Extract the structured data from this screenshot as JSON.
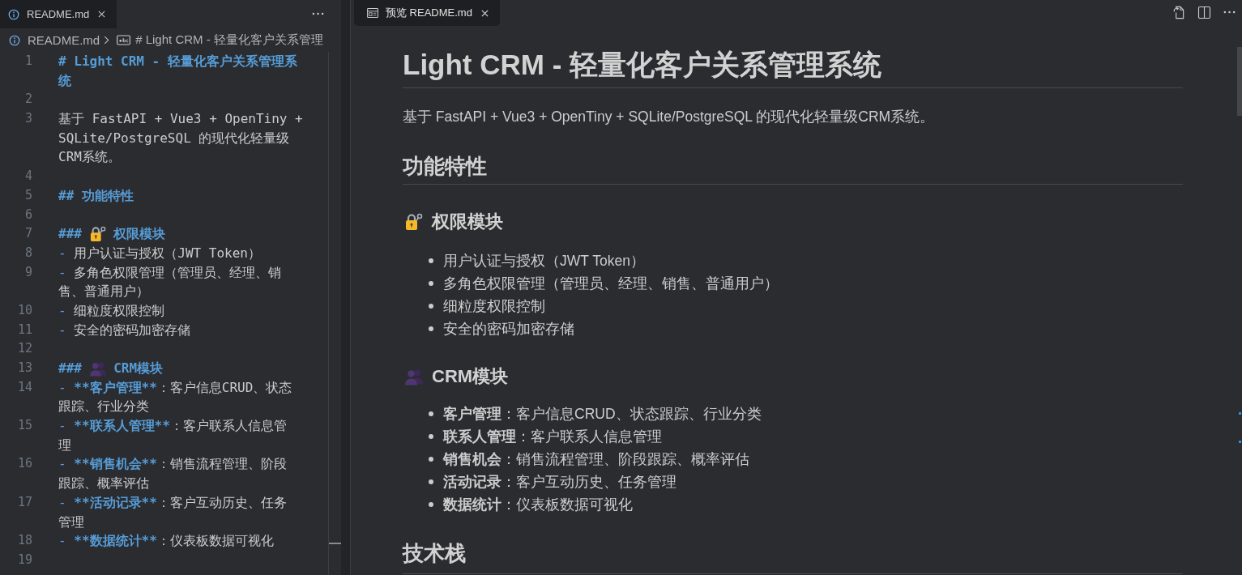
{
  "editor": {
    "tab": {
      "label": "README.md",
      "selected": true
    },
    "breadcrumb": {
      "file": "README.md",
      "symbol": "# Light CRM - 轻量化客户关系管理"
    },
    "lines": [
      {
        "number": "1",
        "rows": [
          [
            {
              "kind": "heading",
              "text": "# Light CRM - 轻量化客户关系管理系"
            }
          ],
          [
            {
              "kind": "heading",
              "text": "统"
            }
          ]
        ]
      },
      {
        "number": "2"
      },
      {
        "number": "3",
        "rows": [
          [
            {
              "kind": "plain",
              "text": "基于 FastAPI + Vue3 + OpenTiny +"
            }
          ],
          [
            {
              "kind": "plain",
              "text": "SQLite/PostgreSQL 的现代化轻量级"
            }
          ],
          [
            {
              "kind": "plain",
              "text": "CRM系统。"
            }
          ]
        ]
      },
      {
        "number": "4"
      },
      {
        "number": "5",
        "rows": [
          [
            {
              "kind": "heading",
              "text": "## 功能特性"
            }
          ]
        ]
      },
      {
        "number": "6"
      },
      {
        "number": "7",
        "rows": [
          [
            {
              "kind": "heading",
              "text": "###"
            },
            {
              "kind": "emoji"
            },
            {
              "kind": "heading",
              "text": "权限模块"
            }
          ]
        ]
      },
      {
        "number": "8",
        "rows": [
          [
            {
              "kind": "dash",
              "text": "-"
            },
            {
              "kind": "plain",
              "text": "用户认证与授权（JWT Token）"
            }
          ]
        ]
      },
      {
        "number": "9",
        "rows": [
          [
            {
              "kind": "dash",
              "text": "-"
            },
            {
              "kind": "plain",
              "text": "多角色权限管理（管理员、经理、销"
            }
          ],
          [
            {
              "kind": "plain",
              "text": "售、普通用户）"
            }
          ]
        ]
      },
      {
        "number": "10",
        "rows": [
          [
            {
              "kind": "dash",
              "text": "-"
            },
            {
              "kind": "plain",
              "text": "细粒度权限控制"
            }
          ]
        ]
      },
      {
        "number": "11",
        "rows": [
          [
            {
              "kind": "dash",
              "text": "-"
            },
            {
              "kind": "plain",
              "text": "安全的密码加密存储"
            }
          ]
        ]
      },
      {
        "number": "12"
      },
      {
        "number": "13",
        "rows": [
          [
            {
              "kind": "heading",
              "text": "###"
            },
            {
              "kind": "emoji"
            },
            {
              "kind": "heading",
              "text": "CRM模块"
            }
          ]
        ]
      },
      {
        "number": "14",
        "rows": [
          [
            {
              "kind": "dash",
              "text": "-"
            },
            {
              "kind": "strong",
              "text": "**客户管理**"
            },
            {
              "kind": "plain",
              "text": "：客户信息CRUD、状态"
            }
          ],
          [
            {
              "kind": "plain",
              "text": "跟踪、行业分类"
            }
          ]
        ]
      },
      {
        "number": "15",
        "rows": [
          [
            {
              "kind": "dash",
              "text": "-"
            },
            {
              "kind": "strong",
              "text": "**联系人管理**"
            },
            {
              "kind": "plain",
              "text": "：客户联系人信息管"
            }
          ],
          [
            {
              "kind": "plain",
              "text": "理"
            }
          ]
        ]
      },
      {
        "number": "16",
        "rows": [
          [
            {
              "kind": "dash",
              "text": "-"
            },
            {
              "kind": "strong",
              "text": "**销售机会**"
            },
            {
              "kind": "plain",
              "text": "：销售流程管理、阶段"
            }
          ],
          [
            {
              "kind": "plain",
              "text": "跟踪、概率评估"
            }
          ]
        ]
      },
      {
        "number": "17",
        "rows": [
          [
            {
              "kind": "dash",
              "text": "-"
            },
            {
              "kind": "strong",
              "text": "**活动记录**"
            },
            {
              "kind": "plain",
              "text": "：客户互动历史、任务"
            }
          ],
          [
            {
              "kind": "plain",
              "text": "管理"
            }
          ]
        ]
      },
      {
        "number": "18",
        "rows": [
          [
            {
              "kind": "dash",
              "text": "-"
            },
            {
              "kind": "strong",
              "text": "**数据统计**"
            },
            {
              "kind": "plain",
              "text": "：仪表板数据可视化"
            }
          ]
        ]
      },
      {
        "number": "19"
      }
    ]
  },
  "preview": {
    "tab": {
      "label": "预览 README.md",
      "selected": true
    },
    "blocks": [
      {
        "kind": "h1",
        "text": "Light CRM - 轻量化客户关系管理系统"
      },
      {
        "kind": "p",
        "text": "基于 FastAPI + Vue3 + OpenTiny + SQLite/PostgreSQL 的现代化轻量级CRM系统。"
      },
      {
        "kind": "h2",
        "text": "功能特性"
      },
      {
        "kind": "h3",
        "text": "权限模块"
      },
      {
        "kind": "list",
        "items": [
          "用户认证与授权（JWT Token）",
          "多角色权限管理（管理员、经理、销售、普通用户）",
          "细粒度权限控制",
          "安全的密码加密存储"
        ]
      },
      {
        "kind": "h3",
        "text": "CRM模块"
      },
      {
        "kind": "list",
        "items": [
          "**客户管理**：客户信息CRUD、状态跟踪、行业分类",
          "**联系人管理**：客户联系人信息管理",
          "**销售机会**：销售流程管理、阶段跟踪、概率评估",
          "**活动记录**：客户互动历史、任务管理",
          "**数据统计**：仪表板数据可视化"
        ]
      },
      {
        "kind": "h2",
        "text": "技术栈"
      }
    ]
  }
}
